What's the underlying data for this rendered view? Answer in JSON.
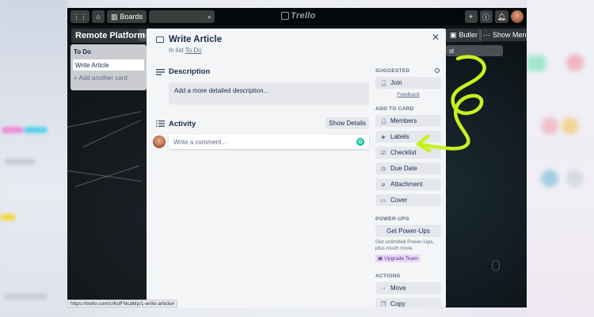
{
  "topbar": {
    "boards_label": "Boards",
    "logo_text": "Trello"
  },
  "board": {
    "title": "Remote Platform",
    "butler_label": "Butler",
    "show_menu_label": "Show Menu",
    "list": {
      "title": "To Do",
      "cards": [
        "Write Article"
      ],
      "add_card_label": "Add another card"
    },
    "partial_input_text": "st"
  },
  "card_modal": {
    "title": "Write Article",
    "in_list_prefix": "In list",
    "list_name": "To Do",
    "description": {
      "heading": "Description",
      "placeholder": "Add a more detailed description..."
    },
    "activity": {
      "heading": "Activity",
      "show_details_label": "Show Details",
      "comment_placeholder": "Write a comment..."
    },
    "sidebar": {
      "suggested_label": "SUGGESTED",
      "join_label": "Join",
      "feedback_label": "Feedback",
      "add_to_card_label": "ADD TO CARD",
      "add_items": [
        {
          "label": "Members",
          "icon": "person-icon"
        },
        {
          "label": "Labels",
          "icon": "tag-icon"
        },
        {
          "label": "Checklist",
          "icon": "checkbox-icon"
        },
        {
          "label": "Due Date",
          "icon": "clock-icon"
        },
        {
          "label": "Attachment",
          "icon": "paperclip-icon"
        },
        {
          "label": "Cover",
          "icon": "cover-icon"
        }
      ],
      "power_ups_label": "POWER-UPS",
      "get_power_ups_label": "Get Power-Ups",
      "power_ups_note": "Get unlimited Power-Ups, plus much more.",
      "upgrade_label": "Upgrade Team",
      "actions_label": "ACTIONS",
      "action_items": [
        {
          "label": "Move",
          "icon": "arrow-right-icon"
        },
        {
          "label": "Copy",
          "icon": "copy-icon"
        }
      ]
    }
  },
  "status_bar": {
    "url": "https://trello.com/c/KdFNcaMp/1-write-article#"
  },
  "colors": {
    "annotation": "#c6f21e",
    "grammarly": "#15c39a",
    "modal_bg": "#f4f5f7"
  }
}
